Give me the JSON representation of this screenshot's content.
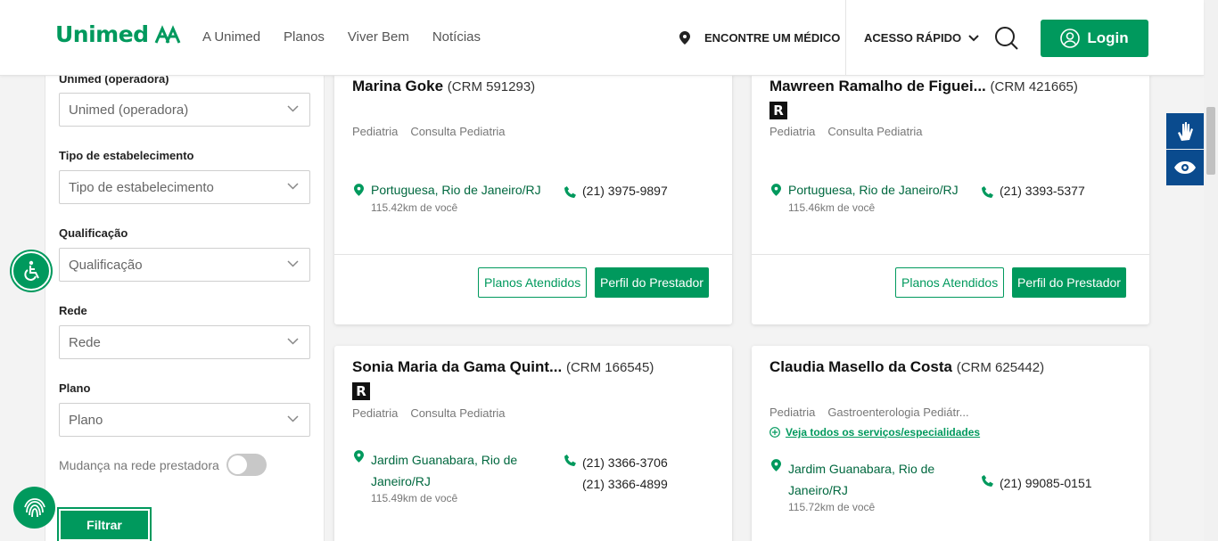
{
  "header": {
    "brand": "Unimed",
    "nav": [
      "A Unimed",
      "Planos",
      "Viver Bem",
      "Notícias"
    ],
    "find_doctor": "ENCONTRE UM MÉDICO",
    "quick_access": "ACESSO RÁPIDO",
    "login": "Login"
  },
  "filters": {
    "operadora_label": "Unimed (operadora)",
    "operadora_value": "Unimed (operadora)",
    "tipo_label": "Tipo de estabelecimento",
    "tipo_value": "Tipo de estabelecimento",
    "qualificacao_label": "Qualificação",
    "qualificacao_value": "Qualificação",
    "rede_label": "Rede",
    "rede_value": "Rede",
    "plano_label": "Plano",
    "plano_value": "Plano",
    "mudanca_label": "Mudança na rede prestadora",
    "filtrar": "Filtrar"
  },
  "cards": [
    {
      "name": "Marina Goke",
      "crm": "(CRM 591293)",
      "badge": "",
      "spec1": "Pediatria",
      "spec2": "Consulta Pediatria",
      "address": "Portuguesa, Rio de Janeiro/RJ",
      "distance": "115.42km de você",
      "phones": [
        "(21) 3975-9897"
      ],
      "btn_planos": "Planos Atendidos",
      "btn_perfil": "Perfil do Prestador"
    },
    {
      "name": "Mawreen Ramalho de Figuei...",
      "crm": "(CRM 421665)",
      "badge": "R",
      "spec1": "Pediatria",
      "spec2": "Consulta Pediatria",
      "address": "Portuguesa, Rio de Janeiro/RJ",
      "distance": "115.46km de você",
      "phones": [
        "(21) 3393-5377"
      ],
      "btn_planos": "Planos Atendidos",
      "btn_perfil": "Perfil do Prestador"
    },
    {
      "name": "Sonia Maria da Gama Quint...",
      "crm": "(CRM 166545)",
      "badge": "R",
      "spec1": "Pediatria",
      "spec2": "Consulta Pediatria",
      "address_l1": "Jardim Guanabara, Rio de",
      "address_l2": "Janeiro/RJ",
      "distance": "115.49km de você",
      "phones": [
        "(21) 3366-3706",
        "(21) 3366-4899"
      ]
    },
    {
      "name": "Claudia Masello da Costa",
      "crm": "(CRM 625442)",
      "spec1": "Pediatria",
      "spec2": "Gastroenterologia Pediátr...",
      "see_all": "Veja todos os serviços/especialidades",
      "address_l1": "Jardim Guanabara, Rio de",
      "address_l2": "Janeiro/RJ",
      "distance": "115.72km de você",
      "phones": [
        "(21) 99085-0151"
      ]
    }
  ],
  "colors": {
    "brand": "#00995d",
    "dark_green": "#00683f",
    "a11y_blue": "#0a4b8e"
  }
}
